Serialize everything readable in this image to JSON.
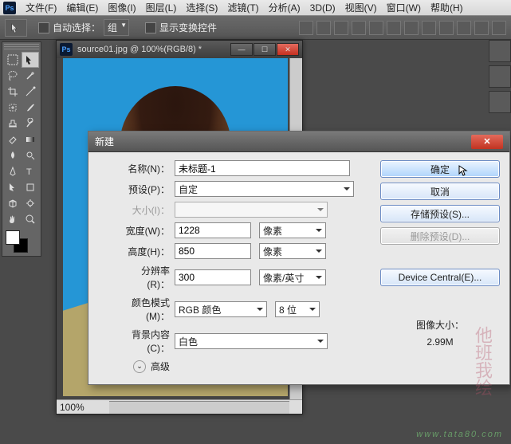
{
  "menu": {
    "items": [
      "文件(F)",
      "编辑(E)",
      "图像(I)",
      "图层(L)",
      "选择(S)",
      "滤镜(T)",
      "分析(A)",
      "3D(D)",
      "视图(V)",
      "窗口(W)",
      "帮助(H)"
    ]
  },
  "options": {
    "auto_select": "自动选择：",
    "group": "组",
    "show_transform": "显示变换控件"
  },
  "doc": {
    "title": "source01.jpg @ 100%(RGB/8) *",
    "zoom": "100%"
  },
  "dialog": {
    "title": "新建",
    "labels": {
      "name": "名称(N)：",
      "preset": "预设(P)：",
      "size": "大小(I)：",
      "width": "宽度(W)：",
      "height": "高度(H)：",
      "resolution": "分辨率(R)：",
      "color_mode": "颜色模式(M)：",
      "background": "背景内容(C)：",
      "advanced": "高级"
    },
    "values": {
      "name": "未标题-1",
      "preset": "自定",
      "width": "1228",
      "height": "850",
      "resolution": "300",
      "color_mode": "RGB 颜色",
      "bit_depth": "8 位",
      "background": "白色"
    },
    "units": {
      "px": "像素",
      "ppi": "像素/英寸"
    },
    "buttons": {
      "ok": "确定",
      "cancel": "取消",
      "save_preset": "存储预设(S)...",
      "delete_preset": "删除预设(D)...",
      "device_central": "Device Central(E)..."
    },
    "image_size_label": "图像大小：",
    "image_size_value": "2.99M"
  },
  "watermark": "www.tata80.com"
}
